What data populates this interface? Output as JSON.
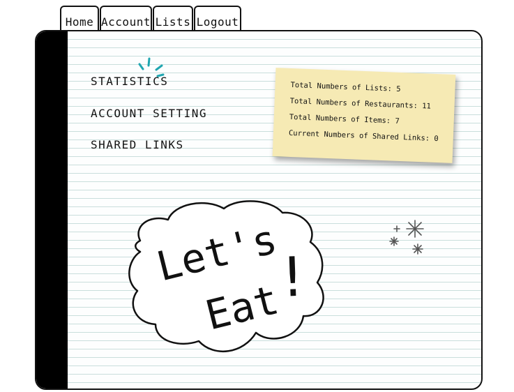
{
  "nav": {
    "tabs": [
      {
        "label": "Home"
      },
      {
        "label": "Account"
      },
      {
        "label": "Lists"
      },
      {
        "label": "Logout"
      }
    ]
  },
  "menu": {
    "items": [
      {
        "label": "STATISTICS"
      },
      {
        "label": "ACCOUNT SETTING"
      },
      {
        "label": "SHARED LINKS"
      }
    ]
  },
  "stats": {
    "lists": {
      "label": "Total Numbers of Lists:",
      "value": "5"
    },
    "restaurants": {
      "label": "Total Numbers of Restaurants:",
      "value": "11"
    },
    "items": {
      "label": "Total Numbers of Items:",
      "value": "7"
    },
    "shared_links": {
      "label": "Current Numbers of Shared Links:",
      "value": "0"
    }
  },
  "hero": {
    "line1": "Let's",
    "line2": "Eat",
    "exclaim": "!"
  },
  "colors": {
    "spine": "#000000",
    "note": "#f6eab4",
    "rule_line": "#c9dedc",
    "accent": "#1fa6b0"
  }
}
